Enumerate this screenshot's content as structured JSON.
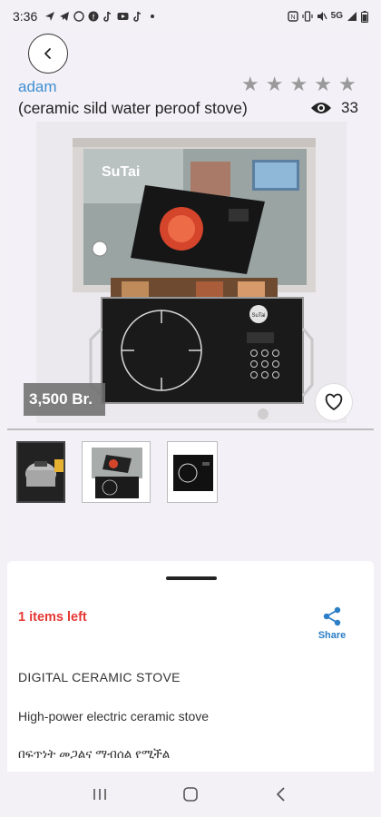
{
  "status_bar": {
    "time": "3:36",
    "left_icons": [
      "navigation-icon",
      "telegram-icon",
      "whatsapp-icon",
      "facebook-icon",
      "tiktok-icon",
      "youtube-icon",
      "tiktok-icon"
    ],
    "right_icons": [
      "nfc-icon",
      "vibrate-icon",
      "mute-icon",
      "5g-signal-icon",
      "signal-icon",
      "battery-icon"
    ],
    "network": "5G"
  },
  "header": {
    "seller": "adam",
    "title": "(ceramic sild water peroof stove)",
    "rating": {
      "stars": 5,
      "filled": 0
    },
    "views": "33"
  },
  "product": {
    "price": "3,500 Br.",
    "image_desc": "stove-photo",
    "brand_text": "SuTai"
  },
  "thumbnails": [
    {
      "name": "thumb-pressure-cooker",
      "active": true
    },
    {
      "name": "thumb-stove-box",
      "active": false
    },
    {
      "name": "thumb-stove-top",
      "active": false
    }
  ],
  "details": {
    "stock": "1 items left",
    "share_label": "Share",
    "product_name": "DIGITAL CERAMIC STOVE",
    "description": "High-power electric ceramic stove",
    "description_amharic": "በፍጥነት መጋልና ማብሰል የሚችል"
  },
  "colors": {
    "seller_link": "#3d8fd1",
    "stock_red": "#e53935",
    "share_blue": "#2a7ec6",
    "star_gray": "#9a9a9a"
  }
}
